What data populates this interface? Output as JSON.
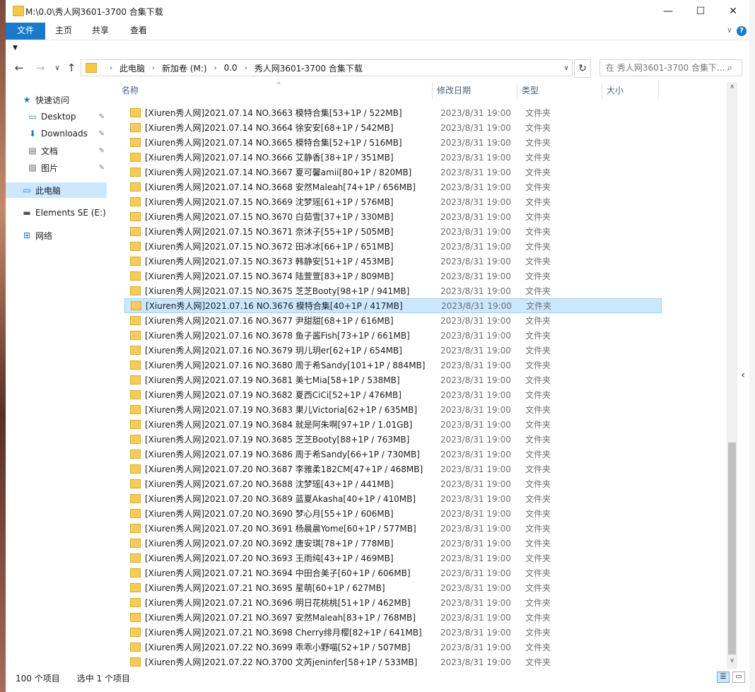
{
  "window": {
    "title": "M:\\0.0\\秀人网3601-3700 合集下载",
    "minimize_glyph": "—",
    "maximize_glyph": "☐",
    "close_glyph": "✕"
  },
  "ribbon": {
    "tabs": [
      "文件",
      "主页",
      "共享",
      "查看"
    ],
    "active_tab": "文件",
    "accent_color": "#1979ca"
  },
  "addressbar": {
    "crumbs": [
      "此电脑",
      "新加卷 (M:)",
      "0.0",
      "秀人网3601-3700 合集下载"
    ]
  },
  "search": {
    "placeholder": "在 秀人网3601-3700 合集下..."
  },
  "nav": {
    "quick_access": "快速访问",
    "desktop": "Desktop",
    "downloads": "Downloads",
    "documents": "文档",
    "pictures": "图片",
    "this_pc": "此电脑",
    "elements": "Elements SE (E:)",
    "network": "网络"
  },
  "columns": {
    "name": "名称",
    "date": "修改日期",
    "type": "类型",
    "size": "大小"
  },
  "files": [
    {
      "name": "[Xiuren秀人网]2021.07.14 NO.3663 模特合集[53+1P / 522MB]",
      "date": "2023/8/31 19:00",
      "type": "文件夹"
    },
    {
      "name": "[Xiuren秀人网]2021.07.14 NO.3664 徐安安[68+1P / 542MB]",
      "date": "2023/8/31 19:00",
      "type": "文件夹"
    },
    {
      "name": "[Xiuren秀人网]2021.07.14 NO.3665 模特合集[52+1P / 516MB]",
      "date": "2023/8/31 19:00",
      "type": "文件夹"
    },
    {
      "name": "[Xiuren秀人网]2021.07.14 NO.3666 艾静香[38+1P / 351MB]",
      "date": "2023/8/31 19:00",
      "type": "文件夹"
    },
    {
      "name": "[Xiuren秀人网]2021.07.14 NO.3667 夏可馨amii[80+1P / 820MB]",
      "date": "2023/8/31 19:00",
      "type": "文件夹"
    },
    {
      "name": "[Xiuren秀人网]2021.07.14 NO.3668 安然Maleah[74+1P / 656MB]",
      "date": "2023/8/31 19:00",
      "type": "文件夹"
    },
    {
      "name": "[Xiuren秀人网]2021.07.15 NO.3669 沈梦瑶[61+1P / 576MB]",
      "date": "2023/8/31 19:00",
      "type": "文件夹"
    },
    {
      "name": "[Xiuren秀人网]2021.07.15 NO.3670 白茹雪[37+1P / 330MB]",
      "date": "2023/8/31 19:00",
      "type": "文件夹"
    },
    {
      "name": "[Xiuren秀人网]2021.07.15 NO.3671 奈沐子[55+1P / 505MB]",
      "date": "2023/8/31 19:00",
      "type": "文件夹"
    },
    {
      "name": "[Xiuren秀人网]2021.07.15 NO.3672 田冰冰[66+1P / 651MB]",
      "date": "2023/8/31 19:00",
      "type": "文件夹"
    },
    {
      "name": "[Xiuren秀人网]2021.07.15 NO.3673 韩静安[51+1P / 453MB]",
      "date": "2023/8/31 19:00",
      "type": "文件夹"
    },
    {
      "name": "[Xiuren秀人网]2021.07.15 NO.3674 陆萱萱[83+1P / 809MB]",
      "date": "2023/8/31 19:00",
      "type": "文件夹"
    },
    {
      "name": "[Xiuren秀人网]2021.07.15 NO.3675 芝芝Booty[98+1P / 941MB]",
      "date": "2023/8/31 19:00",
      "type": "文件夹"
    },
    {
      "name": "[Xiuren秀人网]2021.07.16 NO.3676 模特合集[40+1P / 417MB]",
      "date": "2023/8/31 19:00",
      "type": "文件夹",
      "selected": true
    },
    {
      "name": "[Xiuren秀人网]2021.07.16 NO.3677 尹甜甜[68+1P / 616MB]",
      "date": "2023/8/31 19:00",
      "type": "文件夹"
    },
    {
      "name": "[Xiuren秀人网]2021.07.16 NO.3678 鱼子酱Fish[73+1P / 661MB]",
      "date": "2023/8/31 19:00",
      "type": "文件夹"
    },
    {
      "name": "[Xiuren秀人网]2021.07.16 NO.3679 玥儿玥er[62+1P / 654MB]",
      "date": "2023/8/31 19:00",
      "type": "文件夹"
    },
    {
      "name": "[Xiuren秀人网]2021.07.16 NO.3680 周于希Sandy[101+1P / 884MB]",
      "date": "2023/8/31 19:00",
      "type": "文件夹"
    },
    {
      "name": "[Xiuren秀人网]2021.07.19 NO.3681 美七Mia[58+1P / 538MB]",
      "date": "2023/8/31 19:00",
      "type": "文件夹"
    },
    {
      "name": "[Xiuren秀人网]2021.07.19 NO.3682 夏西CiCi[52+1P / 476MB]",
      "date": "2023/8/31 19:00",
      "type": "文件夹"
    },
    {
      "name": "[Xiuren秀人网]2021.07.19 NO.3683 果儿Victoria[62+1P / 635MB]",
      "date": "2023/8/31 19:00",
      "type": "文件夹"
    },
    {
      "name": "[Xiuren秀人网]2021.07.19 NO.3684 就是阿朱啊[97+1P / 1.01GB]",
      "date": "2023/8/31 19:00",
      "type": "文件夹"
    },
    {
      "name": "[Xiuren秀人网]2021.07.19 NO.3685 芝芝Booty[88+1P / 763MB]",
      "date": "2023/8/31 19:00",
      "type": "文件夹"
    },
    {
      "name": "[Xiuren秀人网]2021.07.19 NO.3686 周于希Sandy[66+1P / 730MB]",
      "date": "2023/8/31 19:00",
      "type": "文件夹"
    },
    {
      "name": "[Xiuren秀人网]2021.07.20 NO.3687 李雅柔182CM[47+1P / 468MB]",
      "date": "2023/8/31 19:00",
      "type": "文件夹"
    },
    {
      "name": "[Xiuren秀人网]2021.07.20 NO.3688 沈梦瑶[43+1P / 441MB]",
      "date": "2023/8/31 19:00",
      "type": "文件夹"
    },
    {
      "name": "[Xiuren秀人网]2021.07.20 NO.3689 蓝夏Akasha[40+1P / 410MB]",
      "date": "2023/8/31 19:00",
      "type": "文件夹"
    },
    {
      "name": "[Xiuren秀人网]2021.07.20 NO.3690 梦心月[55+1P / 606MB]",
      "date": "2023/8/31 19:00",
      "type": "文件夹"
    },
    {
      "name": "[Xiuren秀人网]2021.07.20 NO.3691 杨晨晨Yome[60+1P / 577MB]",
      "date": "2023/8/31 19:00",
      "type": "文件夹"
    },
    {
      "name": "[Xiuren秀人网]2021.07.20 NO.3692 唐安琪[78+1P / 778MB]",
      "date": "2023/8/31 19:00",
      "type": "文件夹"
    },
    {
      "name": "[Xiuren秀人网]2021.07.20 NO.3693 王雨纯[43+1P / 469MB]",
      "date": "2023/8/31 19:00",
      "type": "文件夹"
    },
    {
      "name": "[Xiuren秀人网]2021.07.21 NO.3694 中田合美子[60+1P / 606MB]",
      "date": "2023/8/31 19:00",
      "type": "文件夹"
    },
    {
      "name": "[Xiuren秀人网]2021.07.21 NO.3695 星萌[60+1P / 627MB]",
      "date": "2023/8/31 19:00",
      "type": "文件夹"
    },
    {
      "name": "[Xiuren秀人网]2021.07.21 NO.3696 明日花桃桃[51+1P / 462MB]",
      "date": "2023/8/31 19:00",
      "type": "文件夹"
    },
    {
      "name": "[Xiuren秀人网]2021.07.21 NO.3697 安然Maleah[83+1P / 768MB]",
      "date": "2023/8/31 19:00",
      "type": "文件夹"
    },
    {
      "name": "[Xiuren秀人网]2021.07.21 NO.3698 Cherry绯月樱[82+1P / 641MB]",
      "date": "2023/8/31 19:00",
      "type": "文件夹"
    },
    {
      "name": "[Xiuren秀人网]2021.07.22 NO.3699 乖乖小野喵[52+1P / 507MB]",
      "date": "2023/8/31 19:00",
      "type": "文件夹"
    },
    {
      "name": "[Xiuren秀人网]2021.07.22 NO.3700 文芮jeninfer[58+1P / 533MB]",
      "date": "2023/8/31 19:00",
      "type": "文件夹"
    }
  ],
  "status": {
    "count": "100 个项目",
    "selected": "选中 1 个项目"
  },
  "icons": [
    "folder-icon",
    "back-arrow-icon",
    "forward-arrow-icon",
    "up-arrow-icon",
    "refresh-icon",
    "search-icon",
    "star-icon",
    "pin-icon",
    "computer-icon",
    "drive-icon",
    "network-icon",
    "help-icon"
  ]
}
